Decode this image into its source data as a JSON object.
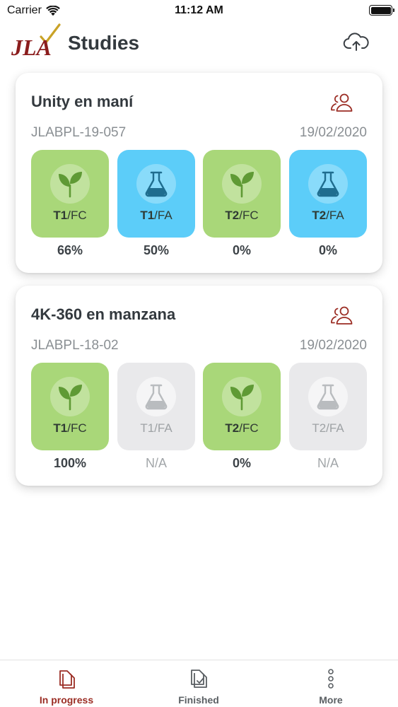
{
  "status_bar": {
    "carrier": "Carrier",
    "time": "11:12 AM"
  },
  "header": {
    "logo_text": "JLA",
    "title": "Studies"
  },
  "studies": [
    {
      "title": "Unity en maní",
      "code": "JLABPL-19-057",
      "date": "19/02/2020",
      "tiles": [
        {
          "treatment": "T1",
          "type": "/FC",
          "percent": "66%",
          "icon": "plant-icon",
          "state": "active"
        },
        {
          "treatment": "T1",
          "type": "/FA",
          "percent": "50%",
          "icon": "flask-icon",
          "state": "active"
        },
        {
          "treatment": "T2",
          "type": "/FC",
          "percent": "0%",
          "icon": "plant-icon",
          "state": "active"
        },
        {
          "treatment": "T2",
          "type": "/FA",
          "percent": "0%",
          "icon": "flask-icon",
          "state": "active"
        }
      ]
    },
    {
      "title": "4K-360 en manzana",
      "code": "JLABPL-18-02",
      "date": "19/02/2020",
      "tiles": [
        {
          "treatment": "T1",
          "type": "/FC",
          "percent": "100%",
          "icon": "plant-icon",
          "state": "active"
        },
        {
          "treatment": "T1",
          "type": "/FA",
          "percent": "N/A",
          "icon": "flask-icon",
          "state": "disabled"
        },
        {
          "treatment": "T2",
          "type": "/FC",
          "percent": "0%",
          "icon": "plant-icon",
          "state": "active"
        },
        {
          "treatment": "T2",
          "type": "/FA",
          "percent": "N/A",
          "icon": "flask-icon",
          "state": "disabled"
        }
      ]
    }
  ],
  "tabbar": {
    "tabs": [
      {
        "label": "In progress",
        "icon": "document-icon",
        "active": true
      },
      {
        "label": "Finished",
        "icon": "document-check-icon",
        "active": false
      },
      {
        "label": "More",
        "icon": "more-icon",
        "active": false
      }
    ]
  },
  "colors": {
    "brand_red": "#9b2d24",
    "green_tile": "#a9d779",
    "blue_tile": "#5ccdf9",
    "disabled_tile": "#e9e9eb"
  }
}
